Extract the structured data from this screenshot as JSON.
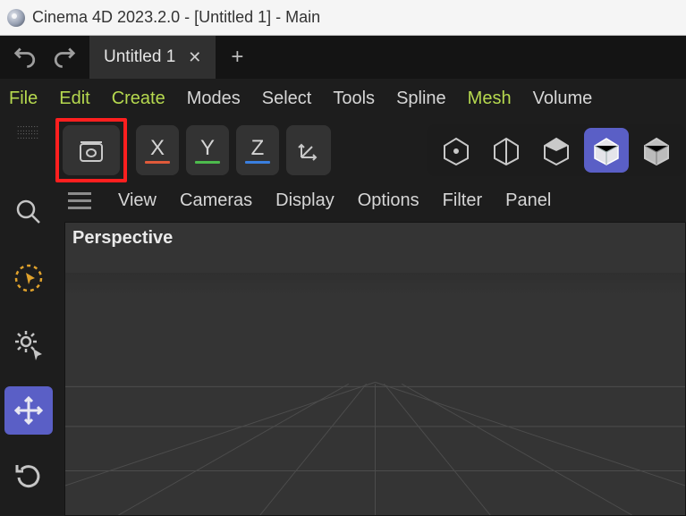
{
  "title": "Cinema 4D 2023.2.0 - [Untitled 1] - Main",
  "tabs": {
    "active": "Untitled 1",
    "close_glyph": "✕",
    "new_glyph": "+"
  },
  "menu": {
    "file": "File",
    "edit": "Edit",
    "create": "Create",
    "modes": "Modes",
    "select": "Select",
    "tools": "Tools",
    "spline": "Spline",
    "mesh": "Mesh",
    "volume": "Volume"
  },
  "axes": {
    "x": "X",
    "y": "Y",
    "z": "Z"
  },
  "viewport_menu": {
    "view": "View",
    "cameras": "Cameras",
    "display": "Display",
    "options": "Options",
    "filter": "Filter",
    "panel": "Panel"
  },
  "viewport_label": "Perspective",
  "icons": {
    "undo": "undo",
    "redo": "redo",
    "project": "project-settings",
    "gizmo": "axis-gizmo",
    "comp_point": "point-mode",
    "comp_edge": "edge-mode",
    "comp_poly": "polygon-mode",
    "comp_model": "model-mode",
    "comp_tex": "texture-mode",
    "search": "search",
    "lasso": "live-selection",
    "gear": "settings",
    "move": "move",
    "rotate": "rotate"
  },
  "colors": {
    "accent": "#5a5fc6",
    "highlight": "#ff1f1f",
    "menu_accent": "#b6d94f"
  }
}
